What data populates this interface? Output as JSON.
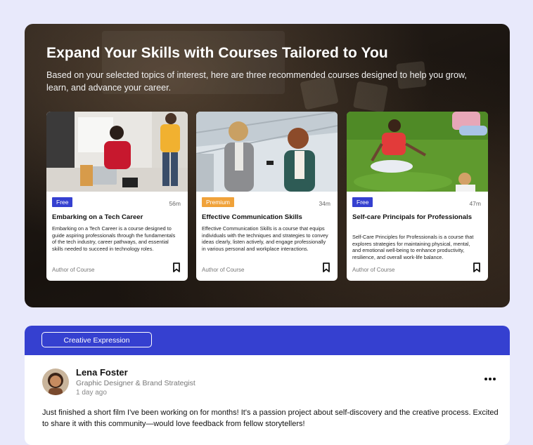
{
  "hero": {
    "title": "Expand Your Skills with Courses Tailored to You",
    "subtitle": "Based on your selected topics of interest, here are three recommended courses designed to help you grow, learn, and advance your career."
  },
  "courses": [
    {
      "badge": "Free",
      "duration": "56m",
      "title": "Embarking on a Tech Career",
      "description": "Embarking on a Tech Career is a course designed to guide aspiring professionals through the fundamentals of the tech industry, career pathways, and essential skills needed to succeed in technology roles.",
      "author": "Author of Course"
    },
    {
      "badge": "Premium",
      "duration": "34m",
      "title": "Effective Communication Skills",
      "description": "Effective Communication Skills is a course that equips individuals with the techniques and strategies to convey ideas clearly, listen actively, and engage professionally in various personal and workplace interactions.",
      "author": "Author of Course"
    },
    {
      "badge": "Free",
      "duration": "47m",
      "title": "Self-care Principals for Professionals",
      "description": "Self-Care Principles for Professionals is a course that explores strategies for maintaining physical, mental, and emotional well-being to enhance productivity, resilience, and overall work-life balance.",
      "author": "Author of Course"
    }
  ],
  "post": {
    "topic": "Creative Expression",
    "author_name": "Lena Foster",
    "author_role": "Graphic Designer & Brand Strategist",
    "time": "1 day ago",
    "text": "Just finished a short film I've been working on for months! It's a passion project about self-discovery and the creative process. Excited to share it with this community—would love feedback from fellow storytellers!"
  },
  "icons": {
    "bookmark": "bookmark-icon",
    "more": "more-horizontal-icon"
  },
  "colors": {
    "accent": "#3540d0",
    "premium": "#f0a23a",
    "page_bg": "#e8e9fb"
  }
}
